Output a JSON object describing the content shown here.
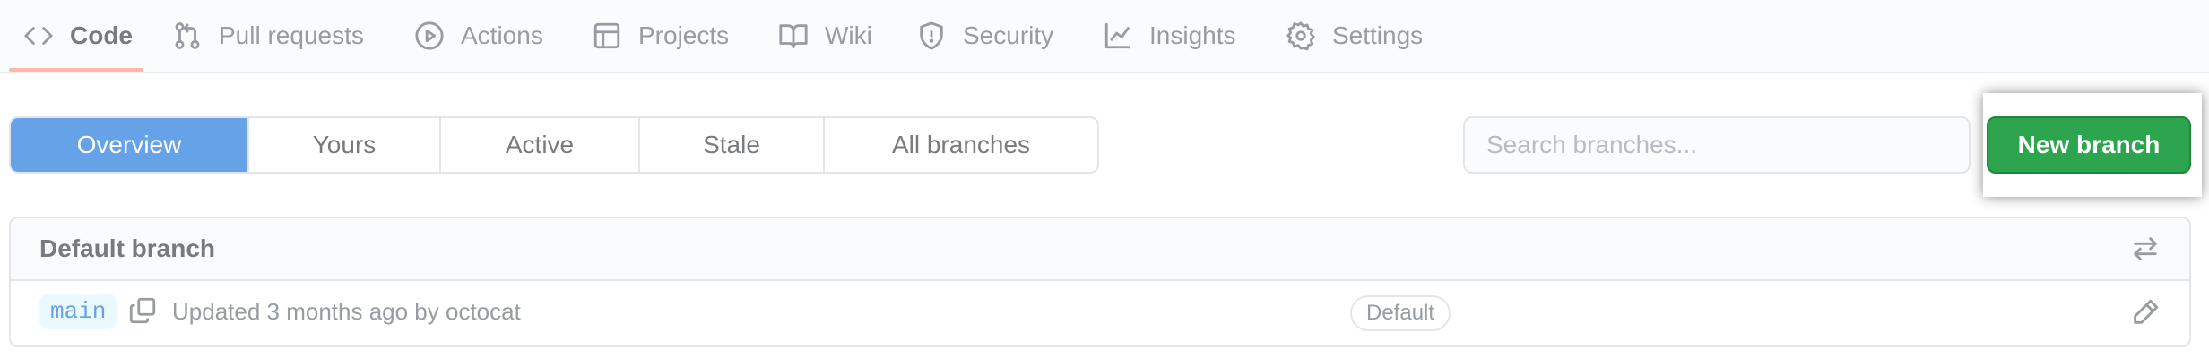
{
  "repo_nav": {
    "items": [
      {
        "label": "Code",
        "icon": "code-icon",
        "selected": true
      },
      {
        "label": "Pull requests",
        "icon": "pull-request-icon"
      },
      {
        "label": "Actions",
        "icon": "play-icon"
      },
      {
        "label": "Projects",
        "icon": "table-icon"
      },
      {
        "label": "Wiki",
        "icon": "book-icon"
      },
      {
        "label": "Security",
        "icon": "shield-icon"
      },
      {
        "label": "Insights",
        "icon": "graph-icon"
      },
      {
        "label": "Settings",
        "icon": "gear-icon"
      }
    ]
  },
  "subnav": {
    "tabs": [
      {
        "label": "Overview",
        "selected": true
      },
      {
        "label": "Yours"
      },
      {
        "label": "Active"
      },
      {
        "label": "Stale"
      },
      {
        "label": "All branches"
      }
    ]
  },
  "search": {
    "placeholder": "Search branches..."
  },
  "new_branch_button": {
    "label": "New branch"
  },
  "default_branch": {
    "title": "Default branch",
    "branch_name": "main",
    "updated": "Updated 3 months ago by octocat",
    "badge": "Default"
  },
  "colors": {
    "accent": "#0969da",
    "primary_button": "#2da44e",
    "nav_underline": "#fd8c73"
  }
}
